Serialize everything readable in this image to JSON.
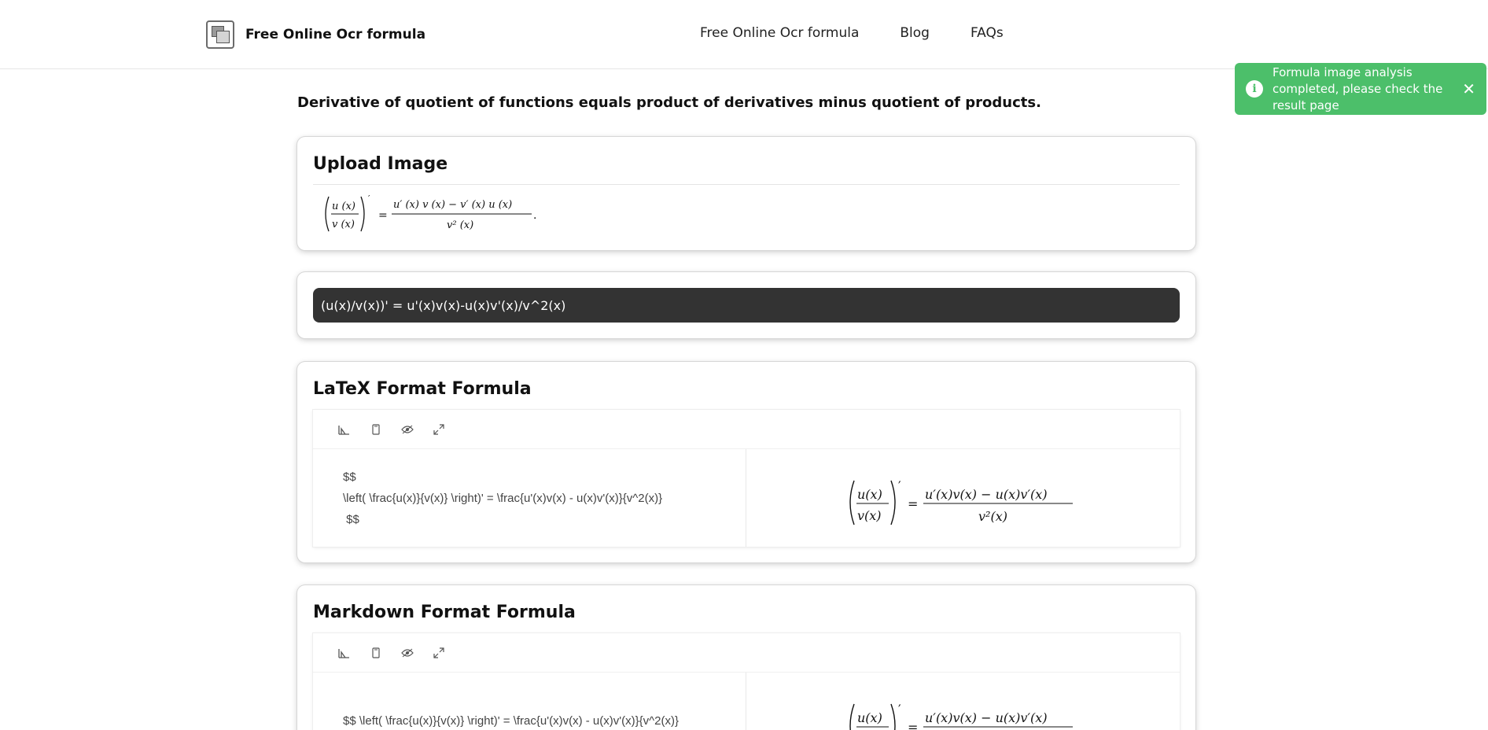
{
  "header": {
    "brand_name": "Free Online Ocr formula",
    "nav": [
      "Free Online Ocr formula",
      "Blog",
      "FAQs"
    ]
  },
  "toast": {
    "message": "Formula image analysis completed, please check the result page",
    "icon": "info-icon",
    "close_icon": "close-icon"
  },
  "lead": "Derivative of quotient of functions equals product of derivatives minus quotient of products.",
  "upload": {
    "title": "Upload Image"
  },
  "result": {
    "text": "(u(x)/v(x))' = u'(x)v(x)-u(x)v'(x)/v^2(x)"
  },
  "latex": {
    "title": "LaTeX Format Formula",
    "toolbar_icons": [
      "preview-icon",
      "copy-icon",
      "eye-icon",
      "fullscreen-icon"
    ],
    "source_lines": [
      "$$",
      "\\left( \\frac{u(x)}{v(x)} \\right)' = \\frac{u'(x)v(x) - u(x)v'(x)}{v^2(x)}",
      " $$"
    ]
  },
  "markdown": {
    "title": "Markdown Format Formula",
    "toolbar_icons": [
      "preview-icon",
      "copy-icon",
      "eye-icon",
      "fullscreen-icon"
    ],
    "source": "$$ \\left( \\frac{u(x)}{v(x)} \\right)' = \\frac{u'(x)v(x) - u(x)v'(x)}{v^2(x)}"
  },
  "colors": {
    "toast_bg": "#4cbf6a",
    "result_bg": "#333333"
  }
}
